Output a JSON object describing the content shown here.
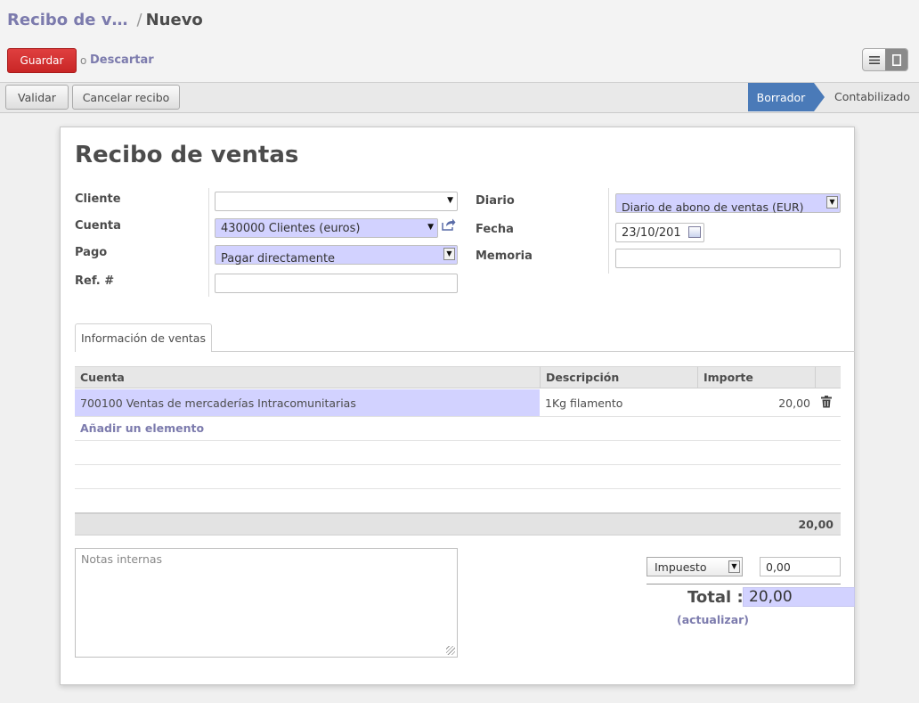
{
  "breadcrumb": {
    "parent": "Recibo de v…",
    "separator": "/",
    "current": "Nuevo"
  },
  "actions": {
    "save": "Guardar",
    "or": "o",
    "discard": "Descartar"
  },
  "view_switch": {
    "list_icon": "list-icon",
    "form_icon": "form-icon",
    "active": "form"
  },
  "statusbar": {
    "buttons": [
      "Validar",
      "Cancelar recibo"
    ],
    "states": [
      "Borrador",
      "Contabilizado"
    ],
    "active_state": "Borrador"
  },
  "form": {
    "title": "Recibo de ventas",
    "left": {
      "cliente": {
        "label": "Cliente",
        "value": ""
      },
      "cuenta": {
        "label": "Cuenta",
        "value": "430000 Clientes (euros)"
      },
      "pago": {
        "label": "Pago",
        "value": "Pagar directamente"
      },
      "ref": {
        "label": "Ref. #",
        "value": ""
      }
    },
    "right": {
      "diario": {
        "label": "Diario",
        "value": "Diario de abono de ventas (EUR)"
      },
      "fecha": {
        "label": "Fecha",
        "value": "23/10/201"
      },
      "memoria": {
        "label": "Memoria",
        "value": ""
      }
    }
  },
  "tabs": [
    "Información de ventas"
  ],
  "lines": {
    "columns": [
      "Cuenta",
      "Descripción",
      "Importe"
    ],
    "rows": [
      {
        "cuenta": "700100 Ventas de mercaderías Intracomunitarias",
        "descripcion": "1Kg filamento",
        "importe": "20,00"
      }
    ],
    "add_item": "Añadir un elemento",
    "footer_total": "20,00"
  },
  "notes": {
    "placeholder": "Notas internas"
  },
  "tax": {
    "label": "Impuesto",
    "amount": "0,00"
  },
  "total": {
    "label": "Total :",
    "value": "20,00",
    "refresh": "(actualizar)"
  },
  "colors": {
    "accent": "#7c7bad",
    "primary_button": "#dc2d2d",
    "state_active": "#4a7ab8",
    "required_field": "#d2d2ff"
  }
}
